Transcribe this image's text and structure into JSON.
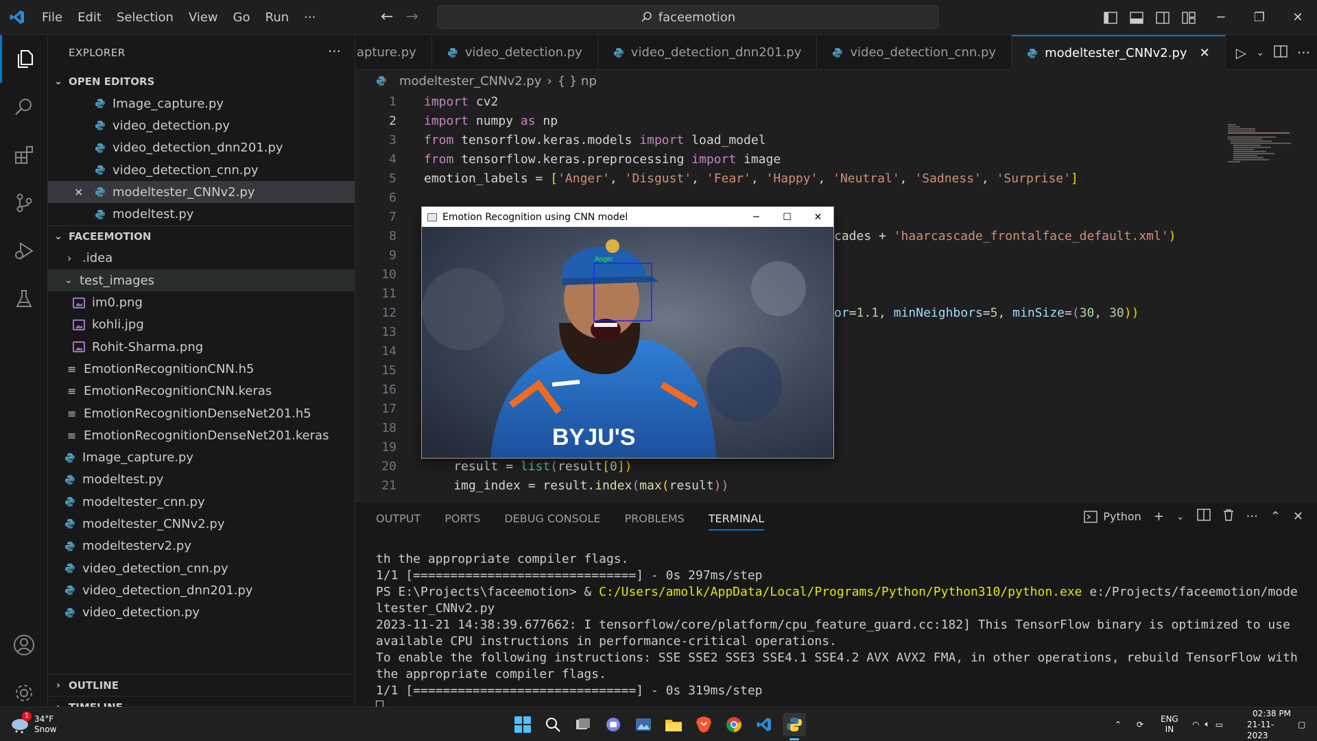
{
  "titlebar": {
    "menu": [
      "File",
      "Edit",
      "Selection",
      "View",
      "Go",
      "Run",
      "···"
    ],
    "search_text": "faceemotion"
  },
  "explorer": {
    "title": "EXPLORER",
    "open_editors_label": "OPEN EDITORS",
    "open_editors": [
      "Image_capture.py",
      "video_detection.py",
      "video_detection_dnn201.py",
      "video_detection_cnn.py",
      "modeltester_CNNv2.py",
      "modeltest.py"
    ],
    "folder_label": "FACEEMOTION",
    "idea": ".idea",
    "test_images": "test_images",
    "images": [
      "im0.png",
      "kohli.jpg",
      "Rohit-Sharma.png"
    ],
    "model_files": [
      "EmotionRecognitionCNN.h5",
      "EmotionRecognitionCNN.keras",
      "EmotionRecognitionDenseNet201.h5",
      "EmotionRecognitionDenseNet201.keras"
    ],
    "py_files": [
      "Image_capture.py",
      "modeltest.py",
      "modeltester_cnn.py",
      "modeltester_CNNv2.py",
      "modeltesterv2.py",
      "video_detection_cnn.py",
      "video_detection_dnn201.py",
      "video_detection.py"
    ],
    "outline": "OUTLINE",
    "timeline": "TIMELINE"
  },
  "tabs": [
    "apture.py",
    "video_detection.py",
    "video_detection_dnn201.py",
    "video_detection_cnn.py",
    "modeltester_CNNv2.py"
  ],
  "breadcrumb": {
    "file": "modeltester_CNNv2.py",
    "symbol": "{ } np"
  },
  "line_numbers": [
    "1",
    "2",
    "3",
    "4",
    "5",
    "6",
    "7",
    "8",
    "9",
    "10",
    "11",
    "12",
    "13",
    "14",
    "15",
    "16",
    "17",
    "18",
    "19",
    "20",
    "21"
  ],
  "code": {
    "l1": [
      "import",
      " cv2"
    ],
    "l2": [
      "import",
      " numpy ",
      "as",
      " np"
    ],
    "l3": [
      "from",
      " tensorflow.keras.models ",
      "import",
      " load_model"
    ],
    "l4": [
      "from",
      " tensorflow.keras.preprocessing ",
      "import",
      " image"
    ],
    "l5": [
      "emotion_labels",
      " = ",
      "[",
      "'Anger'",
      ", ",
      "'Disgust'",
      ", ",
      "'Fear'",
      ", ",
      "'Happy'",
      ", ",
      "'Neutral'",
      ", ",
      "'Sadness'",
      ", ",
      "'Surprise'",
      "]"
    ],
    "l8": [
      "cades + ",
      "'haarcascade_frontalface_default.xml'",
      ")"
    ],
    "l12": [
      "or",
      "=",
      "1.1",
      ", ",
      "minNeighbors",
      "=",
      "5",
      ", ",
      "minSize",
      "=",
      "(",
      "30",
      ", ",
      "30",
      "))"
    ],
    "l20": [
      "    result = ",
      "list",
      "(",
      "result",
      "[",
      "0",
      "])"
    ],
    "l21": [
      "    img_index = result.",
      "index",
      "(",
      "max",
      "(",
      "result",
      "))"
    ]
  },
  "panel": {
    "tabs": [
      "OUTPUT",
      "PORTS",
      "DEBUG CONSOLE",
      "PROBLEMS",
      "TERMINAL"
    ],
    "shell": "Python",
    "lines": [
      "th the appropriate compiler flags.",
      "1/1 [==============================] - 0s 297ms/step",
      "PS E:\\Projects\\faceemotion> & ",
      "C:/Users/amolk/AppData/Local/Programs/Python/Python310/python.exe",
      " e:/Projects/faceemotion/modeltester_CNNv2.py",
      "2023-11-21 14:38:39.677662: I tensorflow/core/platform/cpu_feature_guard.cc:182] This TensorFlow binary is optimized to use available CPU instructions in performance-critical operations.",
      "To enable the following instructions: SSE SSE2 SSE3 SSE4.1 SSE4.2 AVX AVX2 FMA, in other operations, rebuild TensorFlow with the appropriate compiler flags.",
      "1/1 [==============================] - 0s 319ms/step"
    ]
  },
  "cv_window": {
    "title": "Emotion Recognition using CNN model",
    "label": "Anger",
    "jersey_text": "BYJU'S"
  },
  "taskbar": {
    "weather_temp": "34°F",
    "weather_desc": "Snow",
    "weather_badge": "1",
    "lang1": "ENG",
    "lang2": "IN",
    "time": "02:38 PM",
    "date": "21-11-2023"
  }
}
